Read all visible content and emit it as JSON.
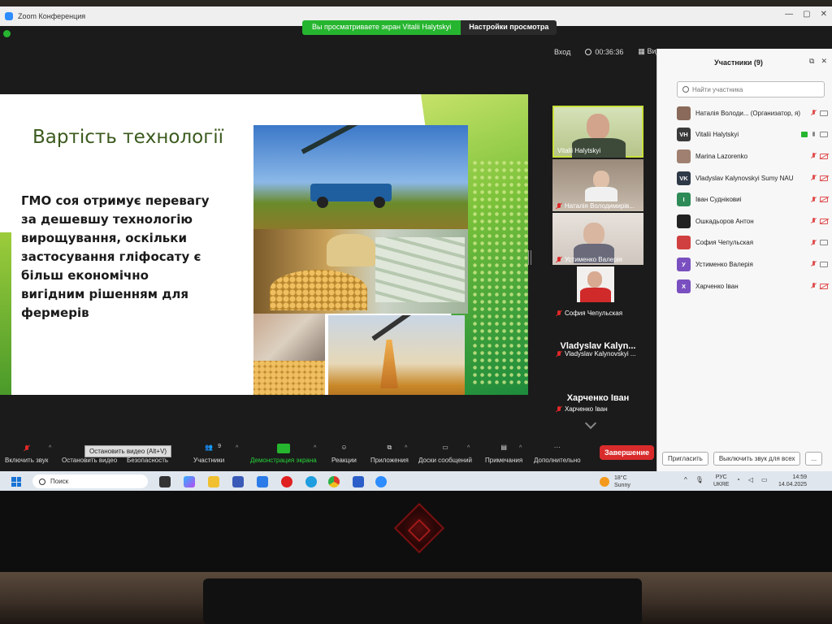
{
  "window": {
    "title": "Zoom Конференция",
    "share_banner": "Вы просматриваете экран Vitalii Halytskyi",
    "view_options": "Настройки просмотра",
    "top_right": {
      "enter_label": "Вход",
      "timer": "00:36:36",
      "view_label": "Вид"
    }
  },
  "slide": {
    "title": "Вартість технології",
    "body": "ГМО соя отримує перевагу за дешевшу технологію вирощування, оскільки застосування гліфосату є більш економічно вигідним рішенням для фермерів"
  },
  "gallery": [
    {
      "name": "Vitalii Halytskyi",
      "muted": false,
      "has_video": true,
      "highlight": true
    },
    {
      "name": "Наталія Володимирів...",
      "muted": true,
      "has_video": true
    },
    {
      "name": "Устименко Валерія",
      "muted": true,
      "has_video": true
    },
    {
      "name": "София Чепульская",
      "muted": true,
      "has_video": true
    },
    {
      "big_name": "Vladyslav Kalyn...",
      "name": "Vladyslav Kalynovskyi ...",
      "muted": true,
      "has_video": false
    },
    {
      "big_name": "Харченко Іван",
      "name": "Харченко Іван",
      "muted": true,
      "has_video": false
    }
  ],
  "participants_panel": {
    "title": "Участники (9)",
    "search_placeholder": "Найти участника",
    "participants": [
      {
        "name": "Наталія Володи... (Организатор, я)",
        "avatar_initials": "",
        "avatar_color": "#8a6a5a",
        "mic_muted": true,
        "video_on": true,
        "sharing": false
      },
      {
        "name": "Vitalii Halytskyi",
        "avatar_initials": "VH",
        "avatar_color": "#3a3a3a",
        "mic_muted": false,
        "video_on": true,
        "sharing": true
      },
      {
        "name": "Marina Lazorenko",
        "avatar_initials": "",
        "avatar_color": "#a08070",
        "mic_muted": true,
        "video_on": false,
        "sharing": false
      },
      {
        "name": "Vladyslav Kalynovskyi Sumy NAU",
        "avatar_initials": "VK",
        "avatar_color": "#2f3a48",
        "mic_muted": true,
        "video_on": false,
        "sharing": false
      },
      {
        "name": "Іван Судніковиі",
        "avatar_initials": "І",
        "avatar_color": "#2e8b57",
        "mic_muted": true,
        "video_on": false,
        "sharing": false
      },
      {
        "name": "Ошкадьоров Антон",
        "avatar_initials": "",
        "avatar_color": "#222222",
        "mic_muted": true,
        "video_on": false,
        "sharing": false
      },
      {
        "name": "София Чепульская",
        "avatar_initials": "",
        "avatar_color": "#d04040",
        "mic_muted": true,
        "video_on": true,
        "sharing": false
      },
      {
        "name": "Устименко Валерія",
        "avatar_initials": "У",
        "avatar_color": "#7a4fc0",
        "mic_muted": true,
        "video_on": true,
        "sharing": false
      },
      {
        "name": "Харченко Іван",
        "avatar_initials": "Х",
        "avatar_color": "#7a4fc0",
        "mic_muted": true,
        "video_on": false,
        "sharing": false
      }
    ],
    "invite_label": "Пригласить",
    "mute_all_label": "Выключить звук для всех",
    "more_label": "..."
  },
  "toolbar": {
    "unmute": "Включить звук",
    "stop_video": "Остановить видео",
    "tooltip": "Остановить видео (Alt+V)",
    "security": "Безопасность",
    "participants": "Участники",
    "participants_count": "9",
    "share_screen": "Демонстрация экрана",
    "reactions": "Реакции",
    "apps": "Приложения",
    "whiteboards": "Доски сообщений",
    "notes": "Примечания",
    "more": "Дополнительно",
    "end": "Завершение"
  },
  "taskbar": {
    "search": "Поиск",
    "weather_temp": "18°C",
    "weather_cond": "Sunny",
    "lang_top": "РУС",
    "lang_bottom": "UKRE",
    "time": "14:59",
    "date": "14.04.2025"
  },
  "colors": {
    "share_green": "#26b52f",
    "end_red": "#d92b2b",
    "zoom_blue": "#2d8cff",
    "slide_green": "#3b5a1e"
  }
}
